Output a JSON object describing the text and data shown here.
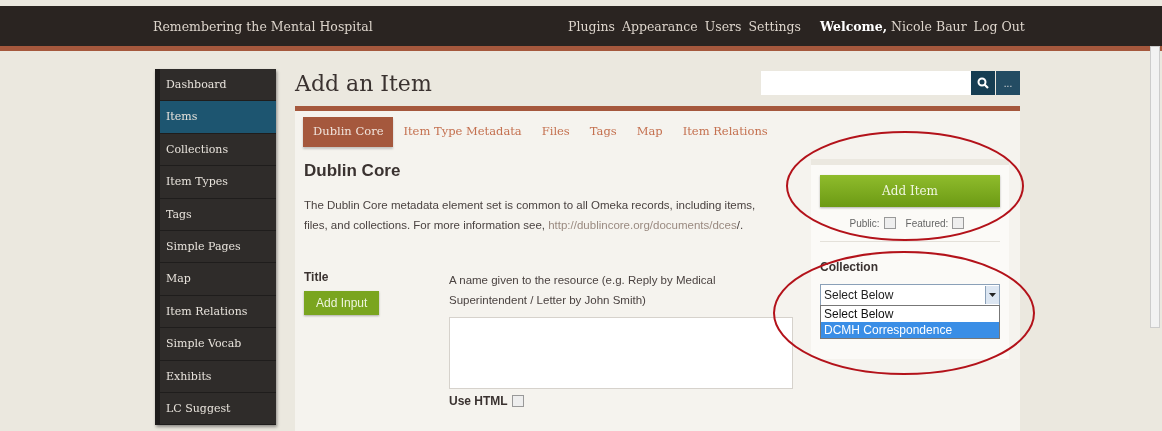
{
  "site_title": "Remembering the Mental Hospital",
  "top_nav": [
    {
      "label": "Plugins"
    },
    {
      "label": "Appearance"
    },
    {
      "label": "Users"
    },
    {
      "label": "Settings"
    }
  ],
  "welcome": {
    "prefix": "Welcome,",
    "name": "Nicole Baur"
  },
  "logout": "Log Out",
  "sidebar": [
    {
      "label": "Dashboard",
      "selected": false
    },
    {
      "label": "Items",
      "selected": true
    },
    {
      "label": "Collections",
      "selected": false
    },
    {
      "label": "Item Types",
      "selected": false
    },
    {
      "label": "Tags",
      "selected": false
    },
    {
      "label": "Simple Pages",
      "selected": false
    },
    {
      "label": "Map",
      "selected": false
    },
    {
      "label": "Item Relations",
      "selected": false
    },
    {
      "label": "Simple Vocab",
      "selected": false
    },
    {
      "label": "Exhibits",
      "selected": false
    },
    {
      "label": "LC Suggest",
      "selected": false
    }
  ],
  "page_title": "Add an Item",
  "search": {
    "more_label": "..."
  },
  "tabs": [
    {
      "label": "Dublin Core",
      "selected": true
    },
    {
      "label": "Item Type Metadata",
      "selected": false
    },
    {
      "label": "Files",
      "selected": false
    },
    {
      "label": "Tags",
      "selected": false
    },
    {
      "label": "Map",
      "selected": false
    },
    {
      "label": "Item Relations",
      "selected": false
    }
  ],
  "section": {
    "heading": "Dublin Core",
    "intro": "The Dublin Core metadata element set is common to all Omeka records, including items, files, and collections. For more information see,",
    "link": "http://dublincore.org/documents/dces",
    "after_link": "/."
  },
  "field": {
    "label": "Title",
    "add_button": "Add Input",
    "description": "A name given to the resource (e.g. Reply by Medical Superintendent / Letter by John Smith)",
    "use_html": {
      "label": "Use HTML",
      "checked": false
    }
  },
  "save_panel": {
    "button": "Add Item",
    "public": {
      "label": "Public:",
      "checked": false
    },
    "featured": {
      "label": "Featured:",
      "checked": false
    },
    "collection_label": "Collection",
    "collection_value": "Select Below",
    "dropdown_open": true,
    "options": [
      {
        "label": "Select Below",
        "selected": false
      },
      {
        "label": "DCMH Correspondence",
        "selected": true
      }
    ]
  }
}
